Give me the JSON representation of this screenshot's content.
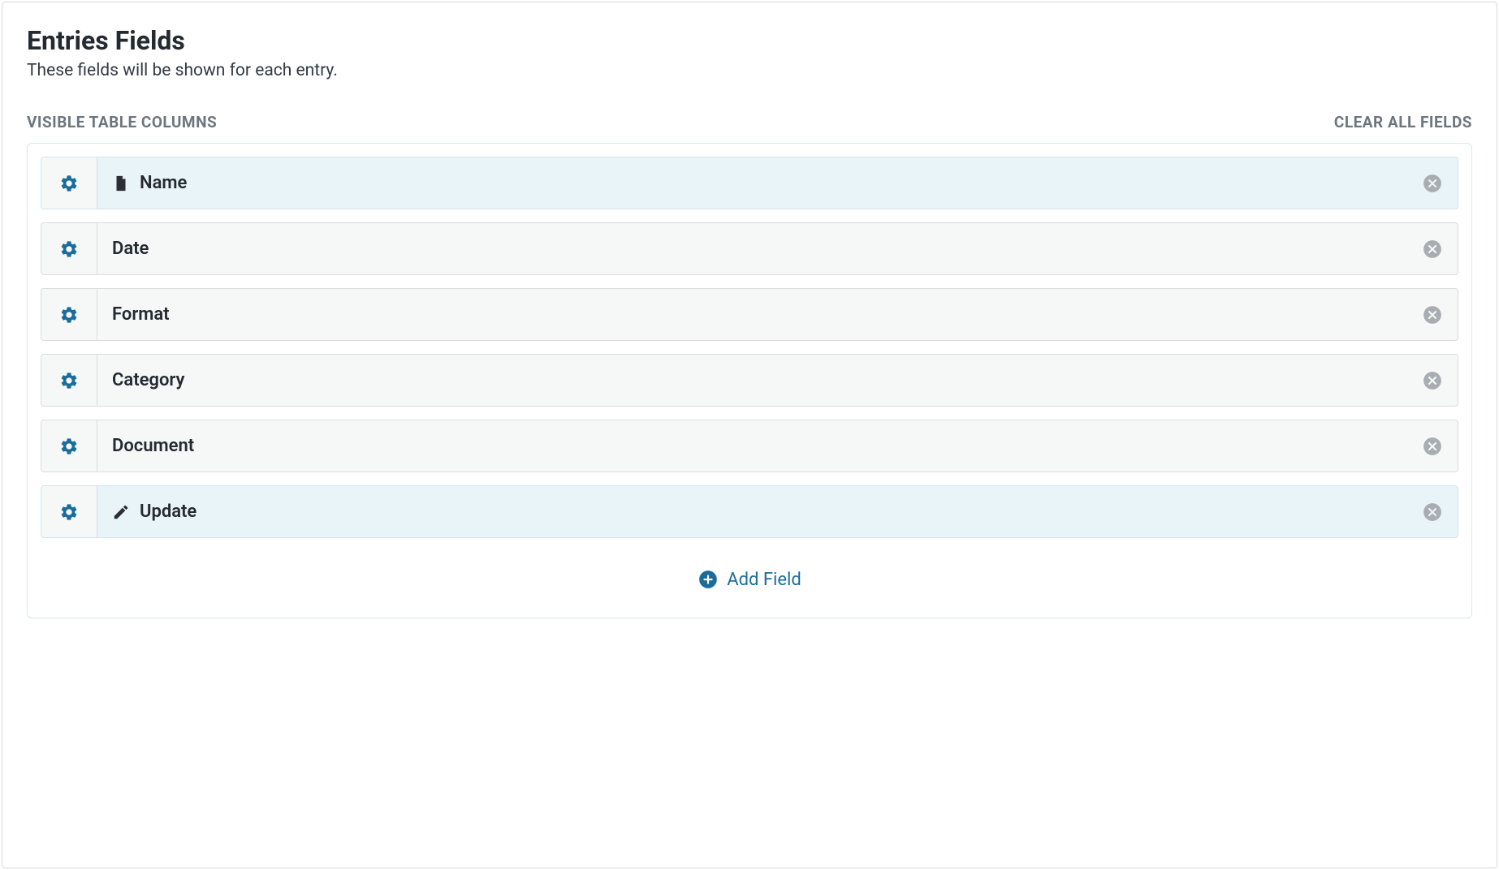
{
  "header": {
    "title": "Entries Fields",
    "subtitle": "These fields will be shown for each entry."
  },
  "section": {
    "label": "VISIBLE TABLE COLUMNS",
    "clear_all": "CLEAR ALL FIELDS"
  },
  "fields": [
    {
      "label": "Name",
      "icon": "file-icon",
      "highlighted": true
    },
    {
      "label": "Date",
      "icon": null,
      "highlighted": false
    },
    {
      "label": "Format",
      "icon": null,
      "highlighted": false
    },
    {
      "label": "Category",
      "icon": null,
      "highlighted": false
    },
    {
      "label": "Document",
      "icon": null,
      "highlighted": false
    },
    {
      "label": "Update",
      "icon": "edit-icon",
      "highlighted": true
    }
  ],
  "actions": {
    "add_field": "Add Field"
  }
}
